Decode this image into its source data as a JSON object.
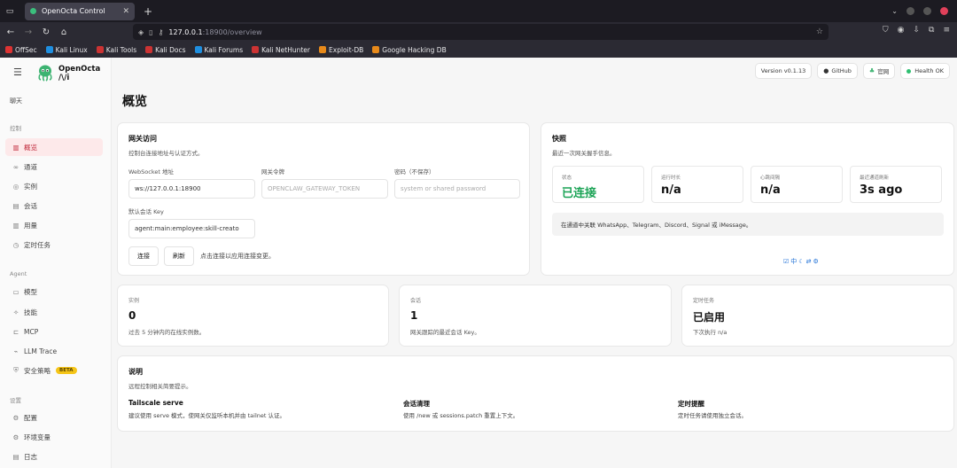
{
  "browser": {
    "tab_title": "OpenOcta Control",
    "url_host": "127.0.0.1",
    "url_rest": ":18900/overview",
    "bookmarks": [
      "OffSec",
      "Kali Linux",
      "Kali Tools",
      "Kali Docs",
      "Kali Forums",
      "Kali NetHunter",
      "Exploit-DB",
      "Google Hacking DB"
    ]
  },
  "brand": {
    "name": "OpenOcta",
    "subtitle": "/\\/i"
  },
  "sidebar": {
    "top_item": "聊天",
    "section_control": "控制",
    "control_items": [
      "概览",
      "通道",
      "实例",
      "会话",
      "用量",
      "定时任务"
    ],
    "section_agent": "Agent",
    "agent_items": [
      "模型",
      "技能",
      "MCP",
      "LLM Trace",
      "安全策略"
    ],
    "beta_label": "BETA",
    "section_settings": "设置",
    "settings_items": [
      "配置",
      "环境变量",
      "日志"
    ]
  },
  "topbar": {
    "version": "Version v0.1.13",
    "github": "GitHub",
    "website": "官网",
    "health": "Health OK"
  },
  "page_title": "概览",
  "gateway": {
    "title": "网关访问",
    "subtitle": "控制台连接地址与认证方式。",
    "ws_label": "WebSocket 地址",
    "ws_value": "ws://127.0.0.1:18900",
    "token_label": "网关令牌",
    "token_placeholder": "OPENCLAW_GATEWAY_TOKEN",
    "password_label": "密码（不保存）",
    "password_placeholder": "system or shared password",
    "session_label": "默认会话 Key",
    "session_value": "agent:main:employee:skill-creato",
    "connect_button": "连接",
    "refresh_button": "刷新",
    "hint": "点击连接以应用连接变更。"
  },
  "snapshot": {
    "title": "快照",
    "subtitle": "最近一次网关握手信息。",
    "stats": [
      {
        "label": "状态",
        "value": "已连接",
        "color": "#1aa355"
      },
      {
        "label": "运行时长",
        "value": "n/a"
      },
      {
        "label": "心跳间隔",
        "value": "n/a"
      },
      {
        "label": "最近通道刷新",
        "value": "3s ago"
      }
    ],
    "notice": "在通道中关联 WhatsApp、Telegram、Discord、Signal 或 iMessage。"
  },
  "summary_cards": [
    {
      "label": "实例",
      "value": "0",
      "sub": "过去 5 分钟内的在线实例数。"
    },
    {
      "label": "会话",
      "value": "1",
      "sub": "网关跟踪的最近会话 Key。"
    },
    {
      "label": "定时任务",
      "value": "已启用",
      "sub": "下次执行 n/a"
    }
  ],
  "notes": {
    "title": "说明",
    "subtitle": "远程控制相关简要提示。",
    "columns": [
      {
        "title": "Tailscale serve",
        "text": "建议使用 serve 模式，使网关仅监听本机并由 tailnet 认证。"
      },
      {
        "title": "会话清理",
        "text": "使用 /new 或 sessions.patch 重置上下文。"
      },
      {
        "title": "定时提醒",
        "text": "定时任务请使用独立会话。"
      }
    ]
  },
  "colors": {
    "accent": "#c0283a",
    "active_bg": "#fde9ea",
    "success": "#1aa355",
    "link": "#1d6fd6"
  }
}
